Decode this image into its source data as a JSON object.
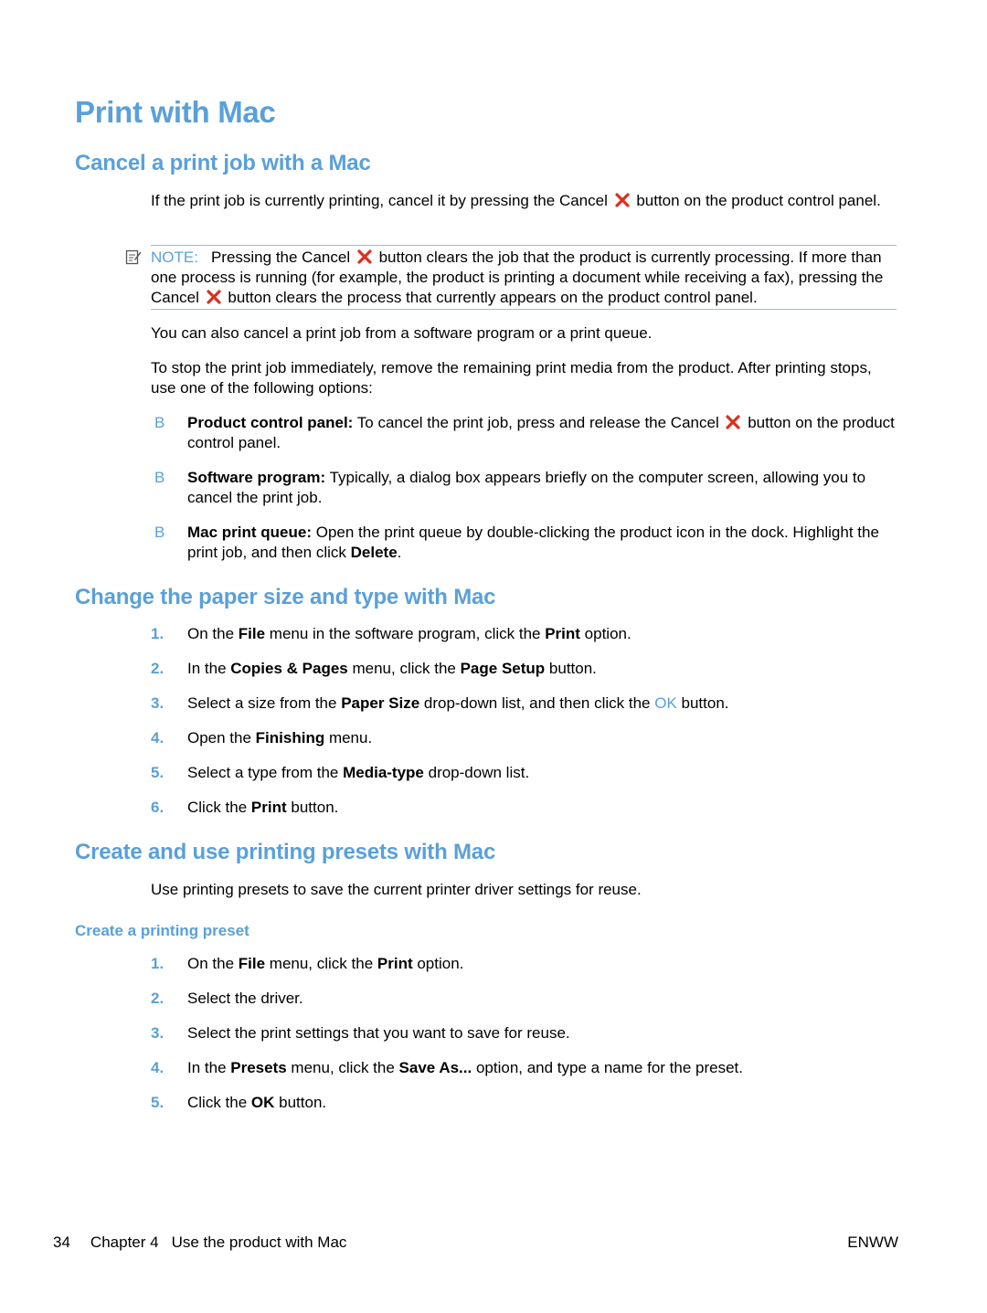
{
  "title": "Print with Mac",
  "sections": {
    "cancel": {
      "heading": "Cancel a print job with a Mac",
      "intro": {
        "before": "If the print job is currently printing, cancel it by pressing the Cancel",
        "after": "button on the product control panel."
      },
      "note": {
        "label": "NOTE:",
        "part1": "Pressing the Cancel",
        "part2": "button clears the job that the product is currently processing. If more than one process is running (for example, the product is printing a document while receiving a fax), pressing the Cancel",
        "part3": "button clears the process that currently appears on the product control panel."
      },
      "para2": "You can also cancel a print job from a software program or a print queue.",
      "para3": "To stop the print job immediately, remove the remaining print media from the product. After printing stops, use one of the following options:",
      "bullet_mark": "B",
      "bullets": [
        {
          "label": "Product control panel:",
          "before": "To cancel the print job, press and release the Cancel",
          "after": "button on the product control panel."
        },
        {
          "label": "Software program:",
          "text": "Typically, a dialog box appears briefly on the computer screen, allowing you to cancel the print job."
        },
        {
          "label": "Mac print queue:",
          "text": "Open the print queue by double-clicking the product icon in the dock. Highlight the print job, and then click",
          "bold_end": "Delete",
          "end": "."
        }
      ]
    },
    "paper": {
      "heading": "Change the paper size and type with Mac",
      "steps": [
        {
          "num": "1.",
          "t1": "On the ",
          "b1": "File",
          "t2": " menu in the software program, click the ",
          "b2": "Print",
          "t3": " option."
        },
        {
          "num": "2.",
          "t1": "In the ",
          "b1": "Copies & Pages",
          "t2": " menu, click the ",
          "b2": "Page Setup",
          "t3": " button."
        },
        {
          "num": "3.",
          "t1": "Select a size from the ",
          "b1": "Paper Size",
          "t2": " drop-down list, and then click the ",
          "link": "OK",
          "t3": " button."
        },
        {
          "num": "4.",
          "t1": "Open the ",
          "b1": "Finishing",
          "t2": " menu."
        },
        {
          "num": "5.",
          "t1": "Select a type from the ",
          "b1": "Media-type",
          "t2": " drop-down list."
        },
        {
          "num": "6.",
          "t1": "Click the ",
          "b1": "Print",
          "t2": " button."
        }
      ]
    },
    "presets": {
      "heading": "Create and use printing presets with Mac",
      "intro": "Use printing presets to save the current printer driver settings for reuse.",
      "subheading": "Create a printing preset",
      "steps": [
        {
          "num": "1.",
          "t1": "On the ",
          "b1": "File",
          "t2": " menu, click the ",
          "b2": "Print",
          "t3": " option."
        },
        {
          "num": "2.",
          "t1": "Select the driver."
        },
        {
          "num": "3.",
          "t1": "Select the print settings that you want to save for reuse."
        },
        {
          "num": "4.",
          "t1": "In the ",
          "b1": "Presets",
          "t2": " menu, click the ",
          "b2": "Save As...",
          "t3": " option, and type a name for the preset."
        },
        {
          "num": "5.",
          "t1": "Click the ",
          "b1": "OK",
          "t2": " button."
        }
      ]
    }
  },
  "footer": {
    "page_number": "34",
    "chapter": "Chapter 4",
    "chapter_title": "Use the product with Mac",
    "right": "ENWW"
  },
  "colors": {
    "heading": "#5aa0d9",
    "cancel_icon": "#d9301f",
    "note_rule": "#8fbfe6"
  },
  "icons": {
    "cancel": "cancel-x-icon",
    "note": "note-pencil-icon"
  }
}
